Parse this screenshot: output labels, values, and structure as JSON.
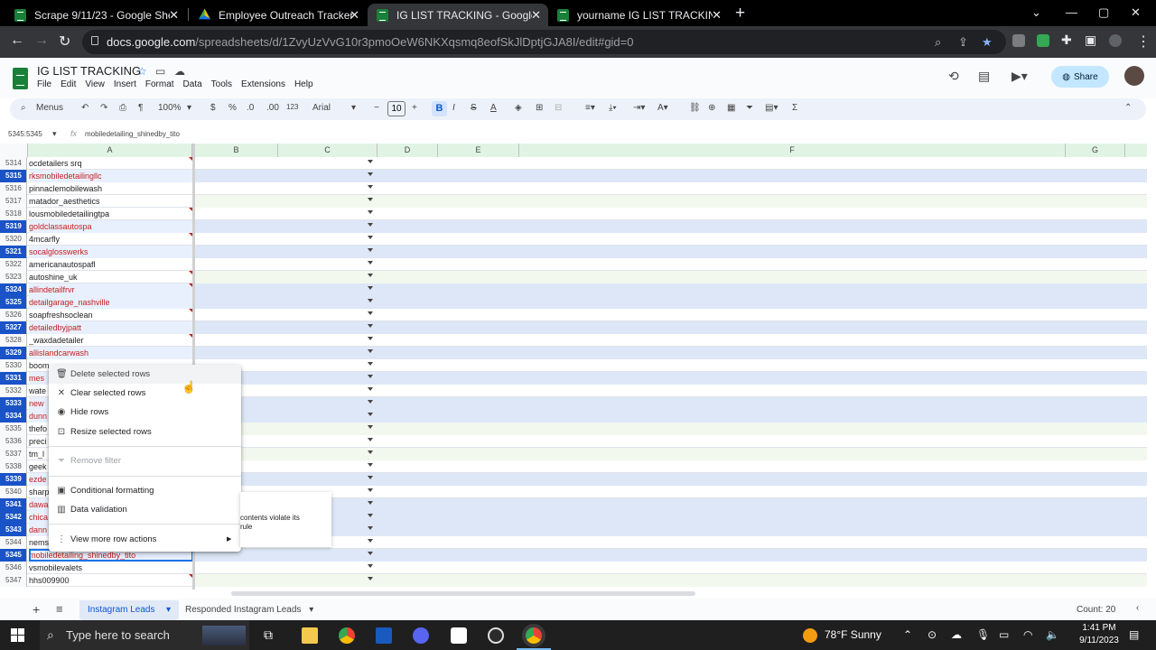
{
  "browser": {
    "tabs": [
      {
        "title": "Scrape 9/11/23 - Google Sheets",
        "icon": "sheets-icon",
        "active": false
      },
      {
        "title": "Employee Outreach Trackers - Go",
        "icon": "drive-icon",
        "active": false
      },
      {
        "title": "IG LIST TRACKING - Google Shee",
        "icon": "sheets-icon",
        "active": true
      },
      {
        "title": "yourname IG LIST TRACKING - Go",
        "icon": "sheets-icon",
        "active": false
      }
    ],
    "url_host": "docs.google.com",
    "url_path": "/spreadsheets/d/1ZvyUzVvG10r3pmoOeW6NKXqsmq8eofSkJlDptjGJA8I/edit#gid=0"
  },
  "sheets": {
    "title": "IG LIST TRACKING",
    "menu": [
      "File",
      "Edit",
      "View",
      "Insert",
      "Format",
      "Data",
      "Tools",
      "Extensions",
      "Help"
    ],
    "share_label": "Share",
    "toolbar": {
      "menus_label": "Menus",
      "zoom": "100%",
      "currency": "$",
      "percent": "%",
      "decrease_decimal": ".0",
      "increase_decimal": ".00",
      "number_format": "123",
      "font": "Arial",
      "font_size": "10"
    },
    "name_box": "5345:5345",
    "formula_value": "mobiledetailing_shinedby_tito",
    "columns": [
      "A",
      "B",
      "C",
      "D",
      "E",
      "F",
      "G"
    ],
    "rows": [
      {
        "n": "5314",
        "a": "ocdetailers srq",
        "sel": false,
        "red": false,
        "note": true
      },
      {
        "n": "5315",
        "a": "rksmobiledetailingllc",
        "sel": true,
        "red": true,
        "note": false
      },
      {
        "n": "5316",
        "a": "pinnaclemobilewash",
        "sel": false,
        "red": false,
        "note": false
      },
      {
        "n": "5317",
        "a": "matador_aesthetics",
        "sel": false,
        "red": false,
        "note": false
      },
      {
        "n": "5318",
        "a": "lousmobiledetailingtpa",
        "sel": false,
        "red": false,
        "note": true
      },
      {
        "n": "5319",
        "a": "goldclassautospa",
        "sel": true,
        "red": true,
        "note": false
      },
      {
        "n": "5320",
        "a": "4mcarfly",
        "sel": false,
        "red": false,
        "note": true
      },
      {
        "n": "5321",
        "a": "socalglosswerks",
        "sel": true,
        "red": true,
        "note": false
      },
      {
        "n": "5322",
        "a": "americanautospafl",
        "sel": false,
        "red": false,
        "note": false
      },
      {
        "n": "5323",
        "a": "autoshine_uk",
        "sel": false,
        "red": false,
        "note": true
      },
      {
        "n": "5324",
        "a": "allindetailfrvr",
        "sel": true,
        "red": true,
        "note": true
      },
      {
        "n": "5325",
        "a": "detailgarage_nashville",
        "sel": true,
        "red": true,
        "note": false
      },
      {
        "n": "5326",
        "a": "soapfreshsoclean",
        "sel": false,
        "red": false,
        "note": true
      },
      {
        "n": "5327",
        "a": "detailedbyjpatt",
        "sel": true,
        "red": true,
        "note": false
      },
      {
        "n": "5328",
        "a": "_waxdadetailer",
        "sel": false,
        "red": false,
        "note": true
      },
      {
        "n": "5329",
        "a": "allislandcarwash",
        "sel": true,
        "red": true,
        "note": false
      },
      {
        "n": "5330",
        "a": "boom",
        "sel": false,
        "red": false,
        "note": false
      },
      {
        "n": "5331",
        "a": "mes",
        "sel": true,
        "red": true,
        "note": false
      },
      {
        "n": "5332",
        "a": "wate",
        "sel": false,
        "red": false,
        "note": false
      },
      {
        "n": "5333",
        "a": "new",
        "sel": true,
        "red": true,
        "note": false
      },
      {
        "n": "5334",
        "a": "dunn",
        "sel": true,
        "red": true,
        "note": false
      },
      {
        "n": "5335",
        "a": "thefo",
        "sel": false,
        "red": false,
        "note": false
      },
      {
        "n": "5336",
        "a": "preci",
        "sel": false,
        "red": false,
        "note": false
      },
      {
        "n": "5337",
        "a": "tm_l",
        "sel": false,
        "red": false,
        "note": false
      },
      {
        "n": "5338",
        "a": "geek",
        "sel": false,
        "red": false,
        "note": false
      },
      {
        "n": "5339",
        "a": "ezde",
        "sel": true,
        "red": true,
        "note": false
      },
      {
        "n": "5340",
        "a": "sharp",
        "sel": false,
        "red": false,
        "note": false
      },
      {
        "n": "5341",
        "a": "dawa",
        "sel": true,
        "red": true,
        "note": false
      },
      {
        "n": "5342",
        "a": "chica",
        "sel": true,
        "red": true,
        "note": false
      },
      {
        "n": "5343",
        "a": "dann",
        "sel": true,
        "red": true,
        "note": false
      },
      {
        "n": "5344",
        "a": "nems",
        "sel": false,
        "red": false,
        "note": false
      },
      {
        "n": "5345",
        "a": "mobiledetailing_shinedby_tito",
        "sel": true,
        "red": true,
        "note": false
      },
      {
        "n": "5346",
        "a": "vsmobilevalets",
        "sel": false,
        "red": false,
        "note": false
      },
      {
        "n": "5347",
        "a": "hhs009900",
        "sel": false,
        "red": false,
        "note": true
      }
    ],
    "context_menu": {
      "delete": "Delete selected rows",
      "clear": "Clear selected rows",
      "hide": "Hide rows",
      "resize": "Resize selected rows",
      "remove_filter": "Remove filter",
      "conditional": "Conditional formatting",
      "validation": "Data validation",
      "more": "View more row actions"
    },
    "tooltip_line1": "contents violate its",
    "tooltip_line2": "rule",
    "sheet_tabs": [
      "Instagram Leads",
      "Responded Instagram Leads"
    ],
    "count": "Count: 20"
  },
  "taskbar": {
    "search_placeholder": "Type here to search",
    "weather": "78°F  Sunny",
    "time": "1:41 PM",
    "date": "9/11/2023"
  },
  "colors": {
    "accent": "#1a73e8",
    "selected_row": "#1a52c8",
    "red_text": "#c5221f",
    "header_green": "#e1f4e3"
  }
}
